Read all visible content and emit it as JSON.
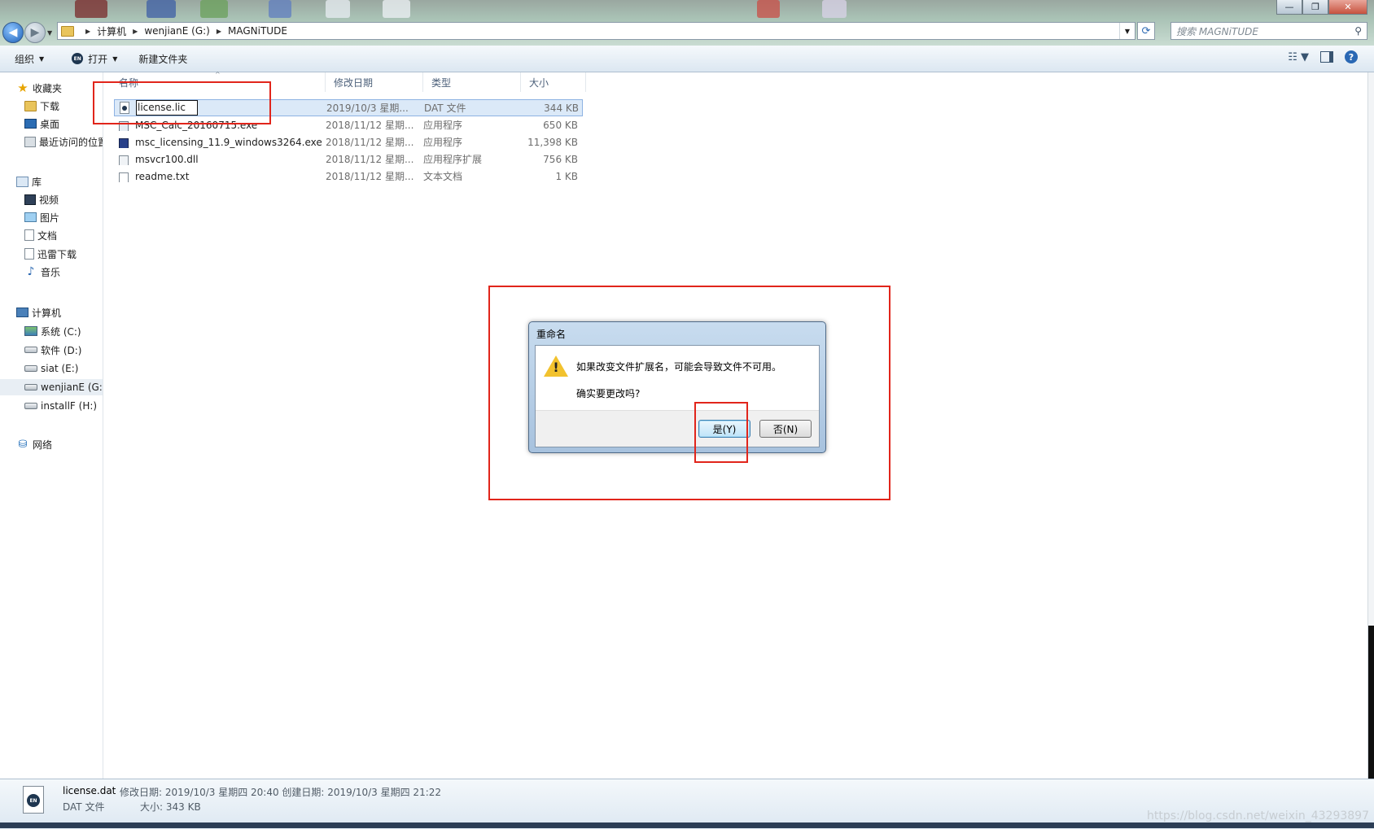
{
  "window": {
    "minimize_glyph": "—",
    "maximize_glyph": "❐",
    "close_glyph": "✕"
  },
  "address": {
    "crumbs": [
      "计算机",
      "wenjianE (G:)",
      "MAGNiTUDE"
    ],
    "search_placeholder": "搜索 MAGNiTUDE"
  },
  "toolbar": {
    "organize": "组织",
    "open": "打开",
    "new_folder": "新建文件夹"
  },
  "sidebar": {
    "favorites": {
      "label": "收藏夹",
      "items": [
        "下载",
        "桌面",
        "最近访问的位置"
      ]
    },
    "libraries": {
      "label": "库",
      "items": [
        "视频",
        "图片",
        "文档",
        "迅雷下载",
        "音乐"
      ]
    },
    "computer": {
      "label": "计算机",
      "items": [
        "系统 (C:)",
        "软件 (D:)",
        "siat (E:)",
        "wenjianE (G:)",
        "installF (H:)"
      ],
      "selected_index": 3
    },
    "network": {
      "label": "网络"
    }
  },
  "columns": {
    "name": "名称",
    "date": "修改日期",
    "type": "类型",
    "size": "大小"
  },
  "files": [
    {
      "name": "license.lic",
      "date": "2019/10/3 星期...",
      "type": "DAT 文件",
      "size": "344 KB",
      "editing": true
    },
    {
      "name": "MSC_Calc_20160715.exe",
      "date": "2018/11/12 星期...",
      "type": "应用程序",
      "size": "650 KB"
    },
    {
      "name": "msc_licensing_11.9_windows3264.exe",
      "date": "2018/11/12 星期...",
      "type": "应用程序",
      "size": "11,398 KB"
    },
    {
      "name": "msvcr100.dll",
      "date": "2018/11/12 星期...",
      "type": "应用程序扩展",
      "size": "756 KB"
    },
    {
      "name": "readme.txt",
      "date": "2018/11/12 星期...",
      "type": "文本文档",
      "size": "1 KB"
    }
  ],
  "dialog": {
    "title": "重命名",
    "message": "如果改变文件扩展名，可能会导致文件不可用。",
    "question": "确实要更改吗?",
    "yes": "是(Y)",
    "no": "否(N)"
  },
  "details": {
    "name": "license.dat",
    "meta": "修改日期: 2019/10/3 星期四 20:40  创建日期: 2019/10/3 星期四 21:22",
    "type": "DAT 文件",
    "size": "大小: 343 KB",
    "icon_badge": "EN"
  },
  "watermark": "https://blog.csdn.net/weixin_43293897"
}
